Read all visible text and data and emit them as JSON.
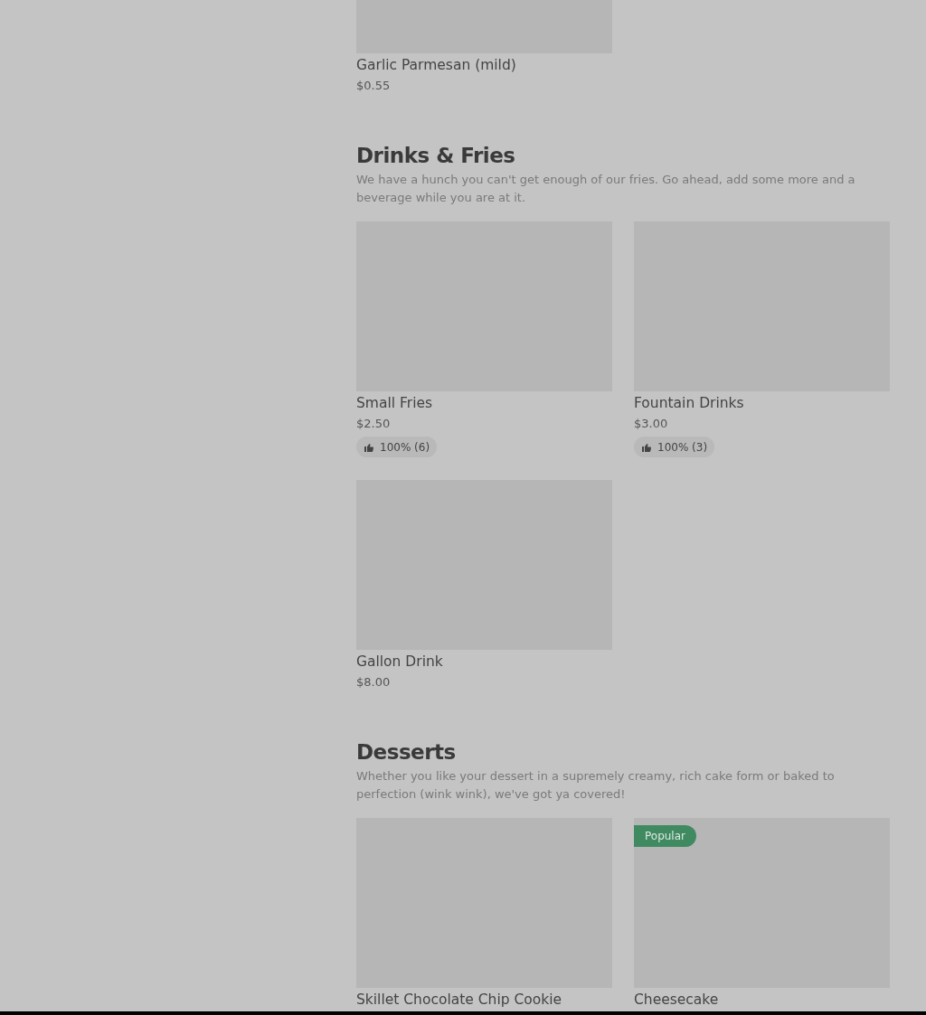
{
  "sections": [
    {
      "items": [
        {
          "name": "Garlic Parmesan (mild)",
          "price": "$0.55"
        }
      ]
    },
    {
      "title": "Drinks & Fries",
      "description": "We have a hunch you can't get enough of our fries. Go ahead, add some more and a beverage while you are at it.",
      "items": [
        {
          "name": "Small Fries",
          "price": "$2.50",
          "rating": "100% (6)"
        },
        {
          "name": "Fountain Drinks",
          "price": "$3.00",
          "rating": "100% (3)"
        },
        {
          "name": "Gallon Drink",
          "price": "$8.00"
        }
      ]
    },
    {
      "title": "Desserts",
      "description": "Whether you like your dessert in a supremely creamy, rich cake form or baked to perfection (wink wink), we've got ya covered!",
      "items": [
        {
          "name": "Skillet Chocolate Chip Cookie"
        },
        {
          "name": "Cheesecake",
          "badge": "Popular"
        }
      ]
    }
  ]
}
